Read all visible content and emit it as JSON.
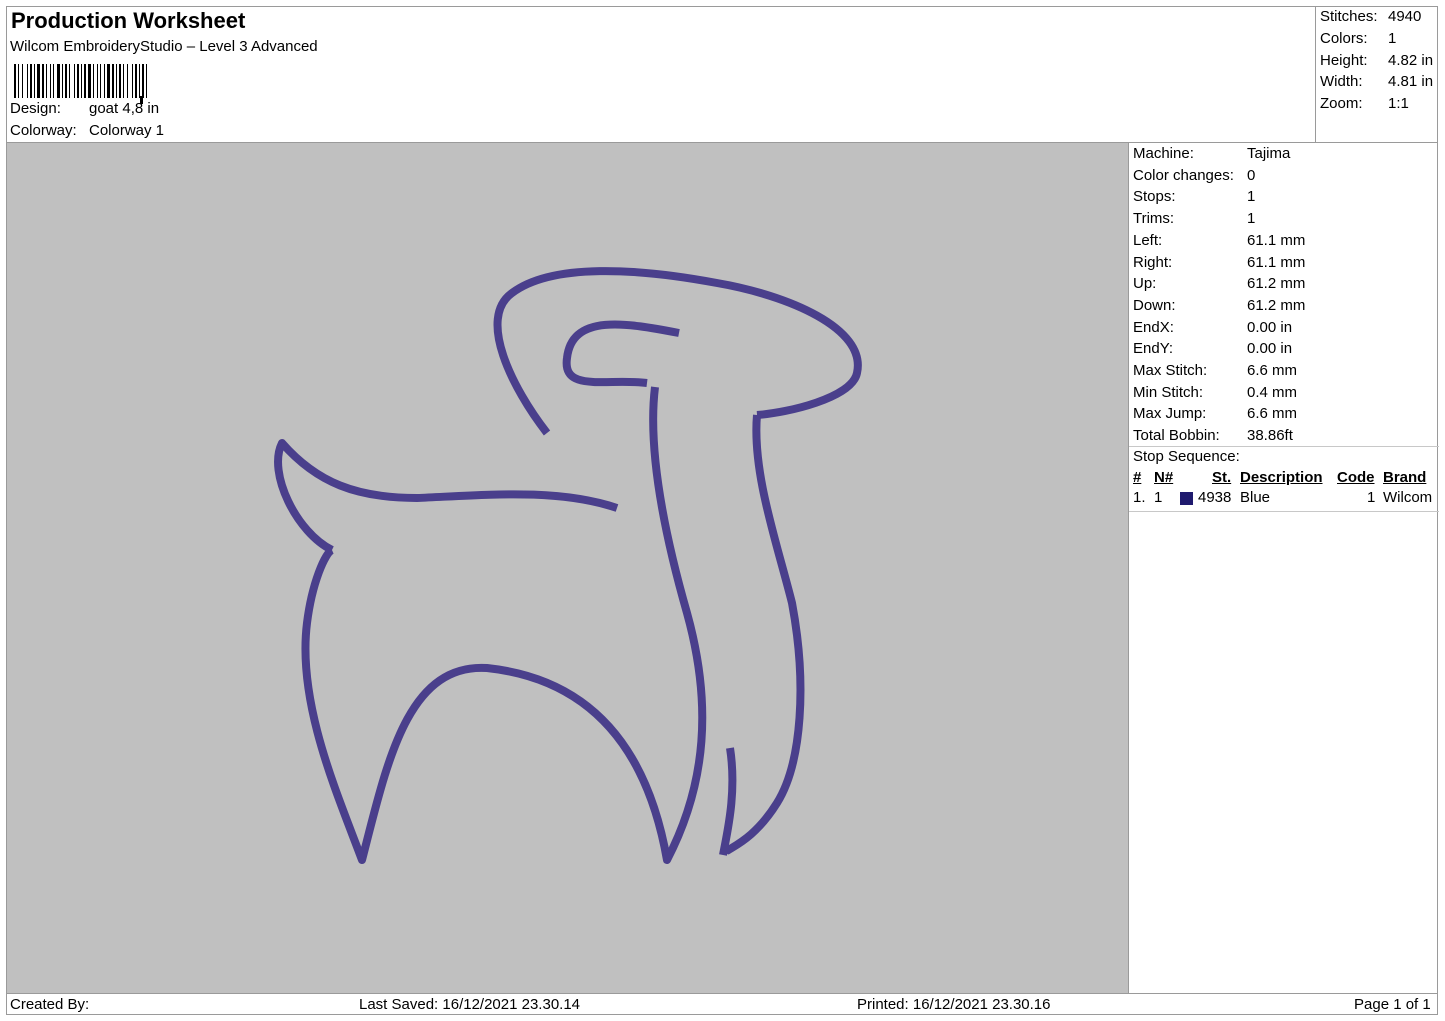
{
  "header": {
    "title": "Production Worksheet",
    "software": "Wilcom EmbroideryStudio – Level 3 Advanced",
    "design_label": "Design:",
    "design_value": "goat 4,8 in",
    "colorway_label": "Colorway:",
    "colorway_value": "Colorway 1"
  },
  "stats": [
    {
      "label": "Stitches:",
      "value": "4940"
    },
    {
      "label": "Colors:",
      "value": "1"
    },
    {
      "label": "Height:",
      "value": "4.82 in"
    },
    {
      "label": "Width:",
      "value": "4.81 in"
    },
    {
      "label": "Zoom:",
      "value": "1:1"
    }
  ],
  "machine_info": [
    {
      "label": "Machine:",
      "value": "Tajima"
    },
    {
      "label": "Color changes:",
      "value": "0"
    },
    {
      "label": "Stops:",
      "value": "1"
    },
    {
      "label": "Trims:",
      "value": "1"
    },
    {
      "label": "Left:",
      "value": "61.1 mm"
    },
    {
      "label": "Right:",
      "value": "61.1 mm"
    },
    {
      "label": "Up:",
      "value": "61.2 mm"
    },
    {
      "label": "Down:",
      "value": "61.2 mm"
    },
    {
      "label": "EndX:",
      "value": "0.00 in"
    },
    {
      "label": "EndY:",
      "value": "0.00 in"
    },
    {
      "label": "Max Stitch:",
      "value": "6.6 mm"
    },
    {
      "label": "Min Stitch:",
      "value": "0.4 mm"
    },
    {
      "label": "Max Jump:",
      "value": "6.6 mm"
    },
    {
      "label": "Total Bobbin:",
      "value": "38.86ft"
    }
  ],
  "stop_sequence": {
    "title": "Stop Sequence:",
    "columns": {
      "num": "#",
      "n": "N#",
      "st": "St.",
      "description": "Description",
      "code": "Code",
      "brand": "Brand"
    },
    "rows": [
      {
        "num": "1.",
        "n": "1",
        "color": "#1f1a6e",
        "st": "4938",
        "description": "Blue",
        "code": "1",
        "brand": "Wilcom"
      }
    ]
  },
  "design": {
    "thread_color": "#4a3f8c"
  },
  "footer": {
    "created_by": "Created By:",
    "last_saved": "Last Saved: 16/12/2021 23.30.14",
    "printed": "Printed: 16/12/2021 23.30.16",
    "page": "Page 1 of 1"
  }
}
